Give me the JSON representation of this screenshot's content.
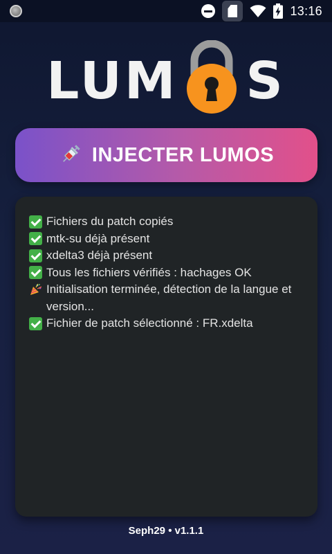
{
  "status_bar": {
    "time": "13:16",
    "icons": [
      "notification-dot-icon",
      "do-not-disturb-icon",
      "sd-card-icon",
      "wifi-icon",
      "battery-charging-icon"
    ]
  },
  "logo": {
    "text_left": "LUM",
    "text_right": "S",
    "lock_icon": "padlock-icon",
    "colors": {
      "lock_body": "#f7931e",
      "shackle": "#9a9a9a",
      "text": "#f2f2f2"
    }
  },
  "inject_button": {
    "label": "INJECTER LUMOS",
    "icon": "syringe-icon",
    "gradient": [
      "#7a52c9",
      "#e2508a"
    ]
  },
  "log": {
    "lines": [
      {
        "icon": "check-icon",
        "text": "Fichiers du patch copiés"
      },
      {
        "icon": "check-icon",
        "text": "mtk-su déjà présent"
      },
      {
        "icon": "check-icon",
        "text": "xdelta3 déjà présent"
      },
      {
        "icon": "check-icon",
        "text": "Tous les fichiers vérifiés : hachages OK"
      },
      {
        "icon": "party-popper-icon",
        "text": "Initialisation terminée, détection de la langue et version..."
      },
      {
        "icon": "check-icon",
        "text": "Fichier de patch sélectionné : FR.xdelta"
      }
    ]
  },
  "footer": {
    "text": "Seph29 • v1.1.1"
  }
}
